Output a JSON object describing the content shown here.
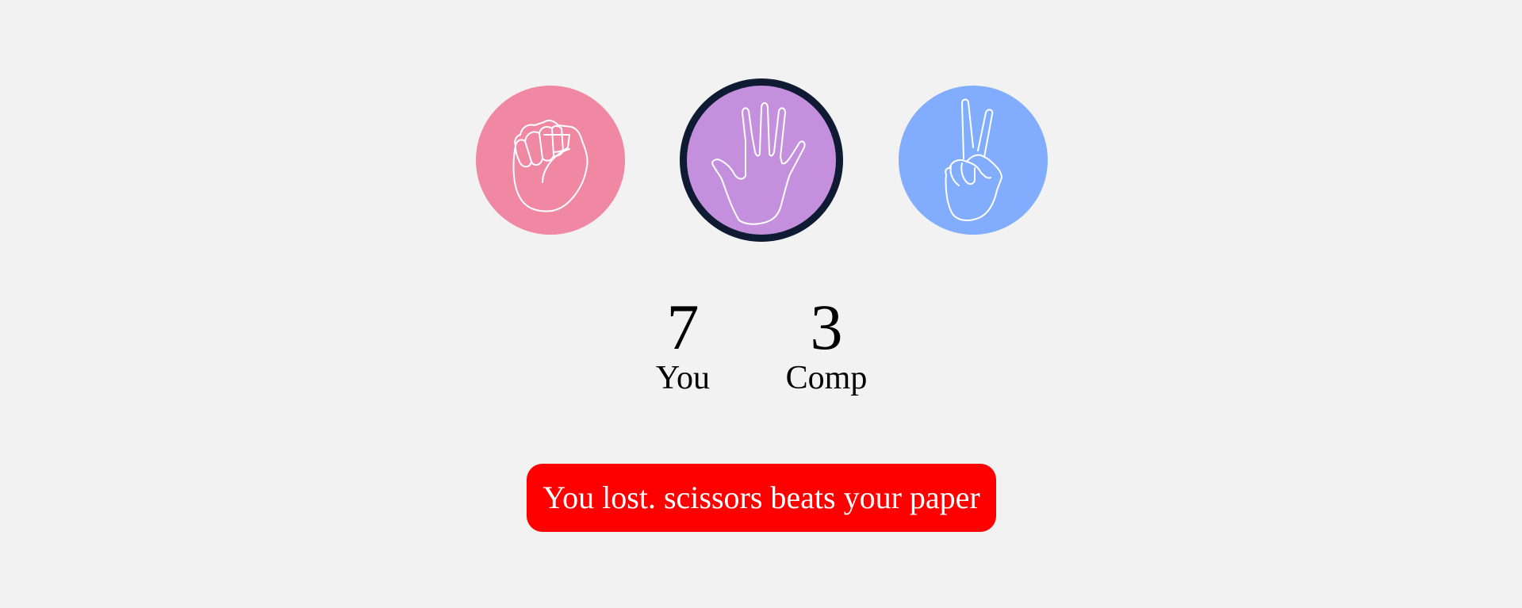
{
  "colors": {
    "background": "#f2f2f2",
    "rock": "#f087a3",
    "paper": "#c490de",
    "scissors": "#82adff",
    "selected_ring": "#0e1b33",
    "result_bg": "#ff0000",
    "result_text": "#ffffff"
  },
  "choices": [
    {
      "id": "rock",
      "icon": "fist-hand-icon",
      "selected": false
    },
    {
      "id": "paper",
      "icon": "open-hand-icon",
      "selected": true
    },
    {
      "id": "scissors",
      "icon": "peace-sign-hand-icon",
      "selected": false
    }
  ],
  "scores": {
    "you": {
      "value": "7",
      "label": "You"
    },
    "comp": {
      "value": "3",
      "label": "Comp"
    }
  },
  "result": {
    "message": "You lost. scissors beats your paper"
  }
}
